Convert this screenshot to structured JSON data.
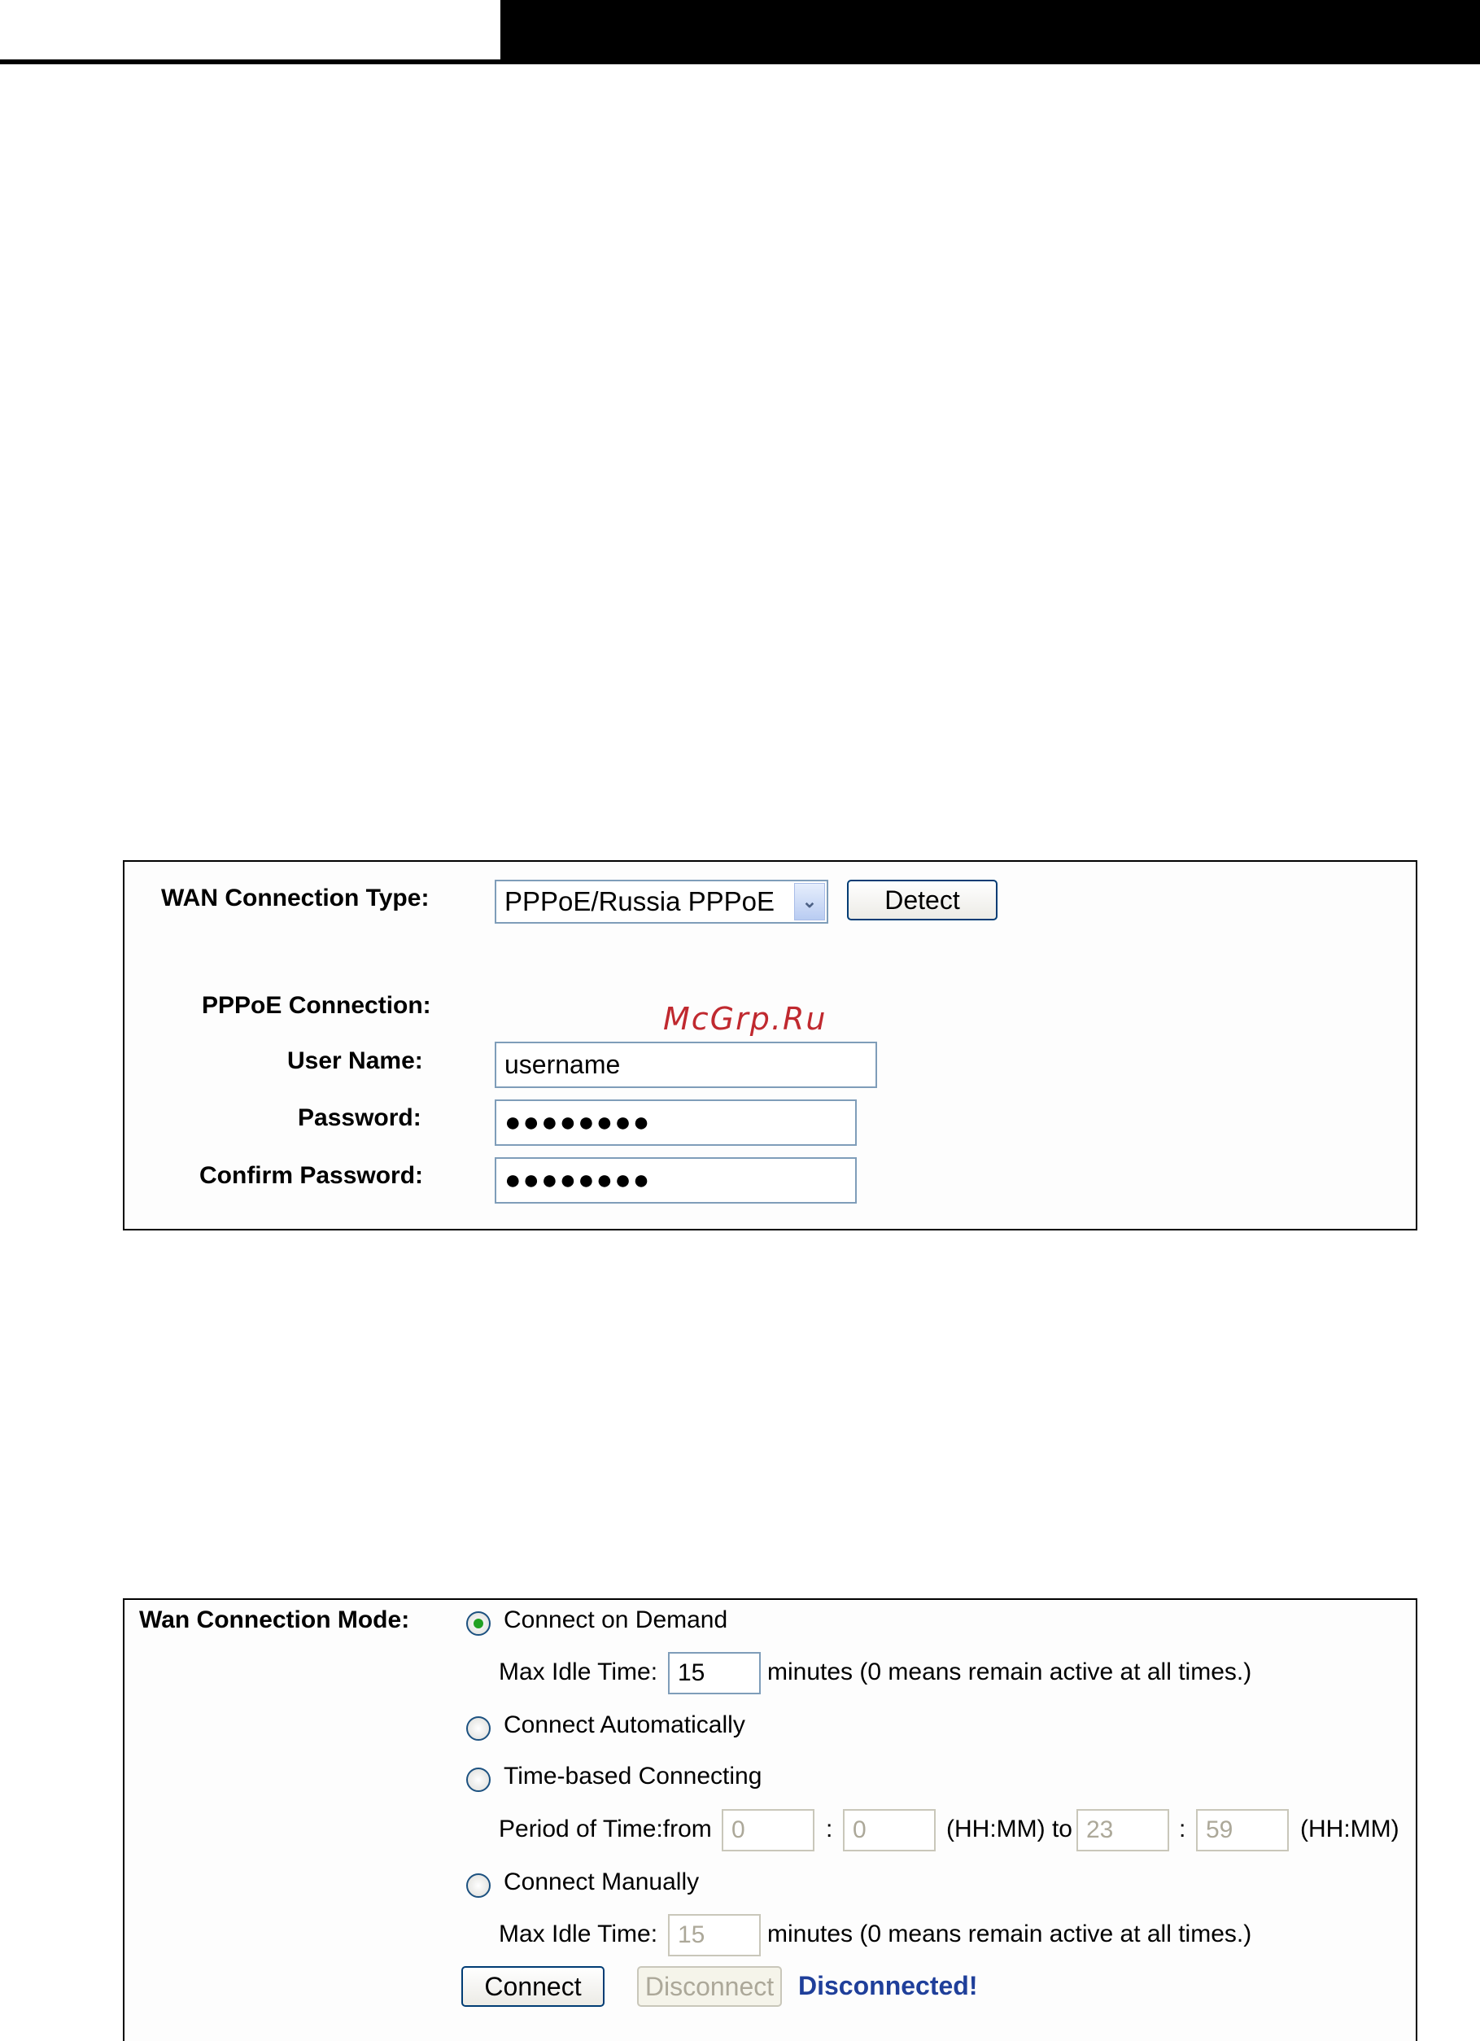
{
  "pppoe_panel": {
    "wan_type_label": "WAN Connection Type:",
    "wan_type_value": "PPPoE/Russia PPPoE",
    "detect_label": "Detect",
    "pppoe_connection_label": "PPPoE Connection:",
    "username_label": "User Name:",
    "username_value": "username",
    "password_label": "Password:",
    "password_value": "●●●●●●●●",
    "confirm_label": "Confirm Password:",
    "confirm_value": "●●●●●●●●"
  },
  "watermark": "McGrp.Ru",
  "mode_panel": {
    "mode_label": "Wan Connection Mode:",
    "on_demand_label": "Connect on Demand",
    "max_idle_label": "Max Idle Time:",
    "max_idle_value": "15",
    "minutes_note": "minutes (0 means remain active at all times.)",
    "auto_label": "Connect Automatically",
    "time_based_label": "Time-based Connecting",
    "period_label": "Period of Time:from",
    "from_hh": "0",
    "sep1": ":",
    "from_mm": "0",
    "hhmm_to": "(HH:MM) to",
    "to_hh": "23",
    "sep2": ":",
    "to_mm": "59",
    "hhmm_end": "(HH:MM)",
    "manual_label": "Connect Manually",
    "manual_idle_label": "Max Idle Time:",
    "manual_idle_value": "15",
    "manual_minutes_note": "minutes (0 means remain active at all times.)",
    "connect_label": "Connect",
    "disconnect_label": "Disconnect",
    "status_text": "Disconnected!",
    "selected_mode": "Connect on Demand"
  },
  "colors": {
    "status": "#1f3f9a",
    "watermark": "#c0292f",
    "radio_checked": "#21a121"
  }
}
